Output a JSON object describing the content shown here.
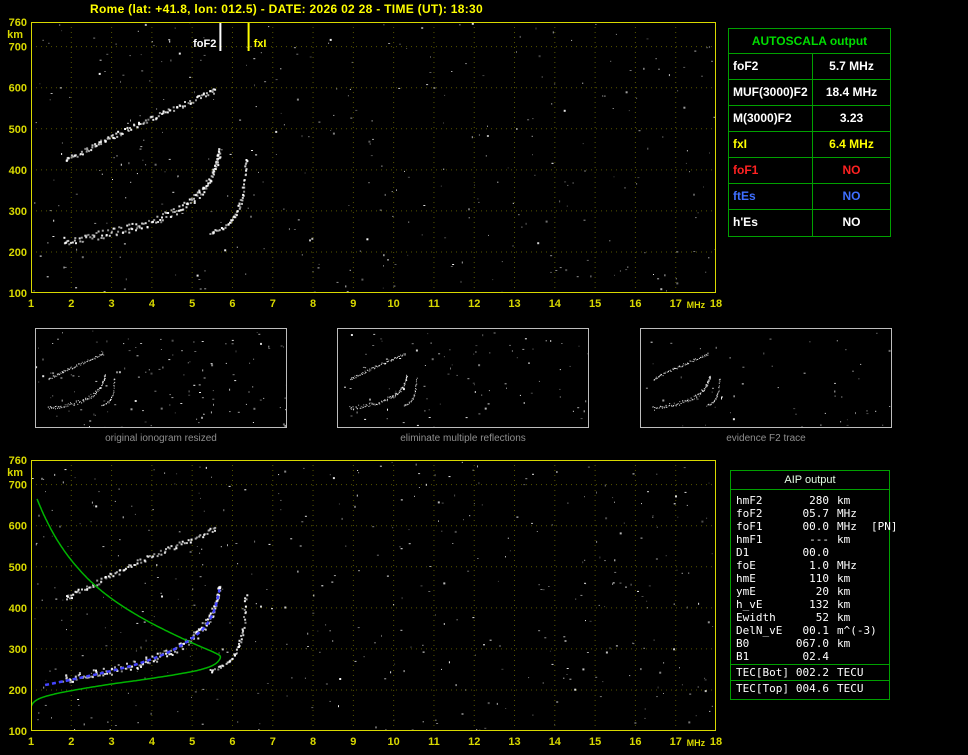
{
  "header": {
    "title": "Rome (lat: +41.8, lon: 012.5) - DATE: 2026 02 28 - TIME (UT): 18:30"
  },
  "colors": {
    "axis": "#d9d900",
    "grid": "#565600",
    "title": "#ffff00",
    "table_border": "#00a000",
    "table_title": "#00dd00",
    "white": "#ffffff",
    "yellow": "#ffff00",
    "red": "#ff2222",
    "blue": "#3f6fff",
    "profile_green": "#00b400",
    "restored_blue": "#4444ff",
    "caption_gray": "#8f8f8f"
  },
  "autoscala_table": {
    "title": "AUTOSCALA output",
    "rows": [
      {
        "label": "foF2",
        "value": "5.7 MHz",
        "color": "white"
      },
      {
        "label": "MUF(3000)F2",
        "value": "18.4 MHz",
        "color": "white"
      },
      {
        "label": "M(3000)F2",
        "value": "3.23",
        "color": "white"
      },
      {
        "label": "fxI",
        "value": "6.4 MHz",
        "color": "yellow"
      },
      {
        "label": "foF1",
        "value": "NO",
        "color": "red"
      },
      {
        "label": "ftEs",
        "value": "NO",
        "color": "blue"
      },
      {
        "label": "h'Es",
        "value": "NO",
        "color": "white"
      }
    ]
  },
  "thumbnails": [
    {
      "caption": "original ionogram resized"
    },
    {
      "caption": "eliminate multiple reflections"
    },
    {
      "caption": "evidence F2 trace"
    }
  ],
  "aip_table": {
    "title": "AIP output",
    "rows": [
      {
        "label": "hmF2",
        "value": "280",
        "unit": "km",
        "extra": ""
      },
      {
        "label": "foF2",
        "value": "05.7",
        "unit": "MHz",
        "extra": ""
      },
      {
        "label": "foF1",
        "value": "00.0",
        "unit": "MHz",
        "extra": "[PN]"
      },
      {
        "label": "hmF1",
        "value": "---",
        "unit": "km",
        "extra": ""
      },
      {
        "label": "D1",
        "value": "00.0",
        "unit": "",
        "extra": ""
      },
      {
        "label": "foE",
        "value": "1.0",
        "unit": "MHz",
        "extra": ""
      },
      {
        "label": "hmE",
        "value": "110",
        "unit": "km",
        "extra": ""
      },
      {
        "label": "ymE",
        "value": "20",
        "unit": "km",
        "extra": ""
      },
      {
        "label": "h_vE",
        "value": "132",
        "unit": "km",
        "extra": ""
      },
      {
        "label": "Ewidth",
        "value": "52",
        "unit": "km",
        "extra": ""
      },
      {
        "label": "DelN_vE",
        "value": "00.1",
        "unit": "m^(-3)",
        "extra": ""
      },
      {
        "label": "B0",
        "value": "067.0",
        "unit": "km",
        "extra": ""
      },
      {
        "label": "B1",
        "value": "02.4",
        "unit": "",
        "extra": ""
      }
    ],
    "tec_rows": [
      {
        "label": "TEC[Bot]",
        "value": "002.2",
        "unit": "TECU",
        "extra": ""
      },
      {
        "label": "TEC[Top]",
        "value": "004.6",
        "unit": "TECU",
        "extra": ""
      }
    ]
  },
  "chart_data": [
    {
      "id": "ionogram-top",
      "type": "scatter",
      "title": "recorded ionogram with autoscaled characteristics",
      "xlabel": "MHz",
      "ylabel": "km",
      "xlim": [
        1,
        18
      ],
      "ylim": [
        100,
        760
      ],
      "xticks": [
        1,
        2,
        3,
        4,
        5,
        6,
        7,
        8,
        9,
        10,
        11,
        12,
        13,
        14,
        15,
        16,
        17,
        18
      ],
      "yticks": [
        100,
        200,
        300,
        400,
        500,
        600,
        700,
        760
      ],
      "grid": true,
      "markers": [
        {
          "label": "foF2",
          "f": 5.7,
          "color": "#ffffff",
          "side": "left"
        },
        {
          "label": "fxI",
          "f": 6.4,
          "color": "#ffff00",
          "side": "right"
        }
      ],
      "traces": [
        {
          "name": "F2-ordinary",
          "points": [
            [
              1.8,
              228
            ],
            [
              2.4,
              238
            ],
            [
              3.0,
              250
            ],
            [
              3.6,
              264
            ],
            [
              4.2,
              284
            ],
            [
              4.7,
              308
            ],
            [
              5.1,
              338
            ],
            [
              5.4,
              374
            ],
            [
              5.58,
              415
            ],
            [
              5.66,
              448
            ]
          ],
          "width": 5,
          "samples": 170
        },
        {
          "name": "F2-extraordinary",
          "points": [
            [
              5.45,
              248
            ],
            [
              5.85,
              266
            ],
            [
              6.1,
              300
            ],
            [
              6.25,
              352
            ],
            [
              6.32,
              430
            ]
          ],
          "width": 2,
          "samples": 55
        },
        {
          "name": "multiple-reflection",
          "points": [
            [
              1.85,
              425
            ],
            [
              2.5,
              458
            ],
            [
              3.2,
              492
            ],
            [
              4.0,
              528
            ],
            [
              4.8,
              562
            ],
            [
              5.55,
              595
            ]
          ],
          "width": 3,
          "samples": 120
        }
      ],
      "noise": {
        "seed": 11,
        "count": 340
      }
    },
    {
      "id": "ionogram-bottom",
      "type": "scatter",
      "title": "ionogram with restored trace and electron density profile",
      "xlabel": "MHz",
      "ylabel": "km",
      "xlim": [
        1,
        18
      ],
      "ylim": [
        100,
        760
      ],
      "xticks": [
        1,
        2,
        3,
        4,
        5,
        6,
        7,
        8,
        9,
        10,
        11,
        12,
        13,
        14,
        15,
        16,
        17,
        18
      ],
      "yticks": [
        100,
        200,
        300,
        400,
        500,
        600,
        700,
        760
      ],
      "grid": true,
      "markers": [],
      "traces": [
        {
          "name": "F2-ordinary",
          "points": [
            [
              1.8,
              228
            ],
            [
              2.4,
              238
            ],
            [
              3.0,
              250
            ],
            [
              3.6,
              264
            ],
            [
              4.2,
              284
            ],
            [
              4.7,
              308
            ],
            [
              5.1,
              338
            ],
            [
              5.4,
              374
            ],
            [
              5.58,
              415
            ],
            [
              5.66,
              448
            ]
          ],
          "width": 5,
          "samples": 170
        },
        {
          "name": "F2-extraordinary",
          "points": [
            [
              5.45,
              248
            ],
            [
              5.85,
              266
            ],
            [
              6.1,
              300
            ],
            [
              6.25,
              352
            ],
            [
              6.32,
              430
            ]
          ],
          "width": 2,
          "samples": 50
        },
        {
          "name": "multiple-reflection",
          "points": [
            [
              1.85,
              425
            ],
            [
              2.5,
              458
            ],
            [
              3.2,
              492
            ],
            [
              4.0,
              528
            ],
            [
              4.8,
              562
            ],
            [
              5.55,
              595
            ]
          ],
          "width": 3,
          "samples": 100
        }
      ],
      "profile": {
        "name": "electron-density-profile",
        "color": "#00b400",
        "points": [
          [
            1.15,
            665
          ],
          [
            1.35,
            620
          ],
          [
            1.65,
            565
          ],
          [
            2.05,
            510
          ],
          [
            2.55,
            458
          ],
          [
            3.15,
            412
          ],
          [
            3.85,
            370
          ],
          [
            4.55,
            335
          ],
          [
            5.15,
            308
          ],
          [
            5.55,
            291
          ],
          [
            5.7,
            280
          ],
          [
            5.55,
            262
          ],
          [
            5.15,
            248
          ],
          [
            4.5,
            236
          ],
          [
            3.7,
            224
          ],
          [
            2.9,
            213
          ],
          [
            2.1,
            200
          ],
          [
            1.5,
            188
          ],
          [
            1.15,
            176
          ],
          [
            1.0,
            158
          ],
          [
            0.98,
            120
          ]
        ]
      },
      "restored": {
        "name": "restored-F2-trace",
        "color": "#4444ff",
        "points": [
          [
            1.35,
            212
          ],
          [
            2.0,
            225
          ],
          [
            2.8,
            242
          ],
          [
            3.6,
            262
          ],
          [
            4.3,
            287
          ],
          [
            4.85,
            316
          ],
          [
            5.3,
            352
          ],
          [
            5.55,
            395
          ],
          [
            5.68,
            445
          ]
        ]
      },
      "noise": {
        "seed": 23,
        "count": 400
      }
    }
  ]
}
